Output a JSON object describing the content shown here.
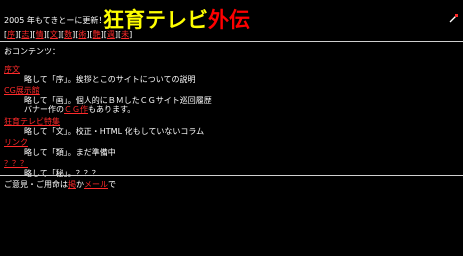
{
  "header": {
    "note": "2005 年もてきとーに更新！",
    "title_main": "狂育テレビ",
    "title_accent": "外伝"
  },
  "nav": {
    "items": [
      "序",
      "志",
      "情",
      "文",
      "数",
      "術",
      "艶",
      "週",
      "未"
    ]
  },
  "contents": {
    "heading": "おコンテンツ：",
    "items": [
      {
        "link": "序文",
        "lines": [
          "略して「序」。挨拶とこのサイトについての説明"
        ]
      },
      {
        "link": "CG展示館",
        "lines": [
          "略して「画」。個人的にＢＭしたＣＧサイト巡回履歴"
        ],
        "extra": {
          "before": "バナー作の",
          "link": "ＣＧ作",
          "after": "もあります。"
        }
      },
      {
        "link": "狂育テレビ特集",
        "lines": [
          "略して「文」。校正・HTML 化もしていないコラム"
        ]
      },
      {
        "link": "リンク",
        "lines": [
          "略して「類」。まだ準備中"
        ]
      },
      {
        "link": "？？？",
        "lines": [
          "略して「秘」。？？？"
        ]
      }
    ]
  },
  "footer": {
    "text_before": "ご意見・ご用命は",
    "link1": "掲",
    "text_mid": "か",
    "link2": "メール",
    "text_after": "で"
  },
  "colors": {
    "background": "#000000",
    "title_yellow": "#ffff00",
    "title_red": "#ff0000",
    "link_red": "#ff2a2a"
  }
}
